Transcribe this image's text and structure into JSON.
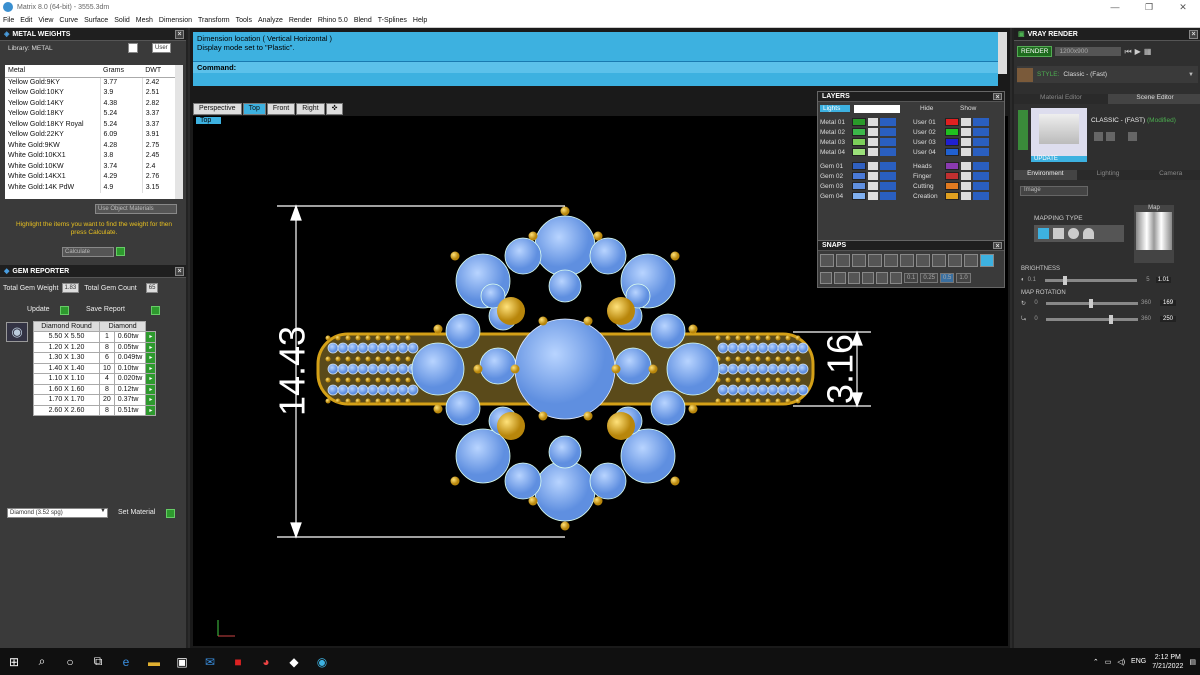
{
  "window": {
    "title": "Matrix 8.0 (64-bit) - 3555.3dm",
    "controls": [
      "—",
      "❐",
      "✕"
    ]
  },
  "menu": [
    "File",
    "Edit",
    "View",
    "Curve",
    "Surface",
    "Solid",
    "Mesh",
    "Dimension",
    "Transform",
    "Tools",
    "Analyze",
    "Render",
    "Rhino 5.0",
    "Blend",
    "T-Splines",
    "Help"
  ],
  "metal_weights": {
    "title": "METAL WEIGHTS",
    "library": "Library: METAL",
    "btn_user": "User",
    "col_metal": "Metal",
    "col_grams": "Grams",
    "col_dwt": "DWT",
    "rows": [
      [
        "Yellow Gold:9KY",
        "3.77",
        "2.42"
      ],
      [
        "Yellow Gold:10KY",
        "3.9",
        "2.51"
      ],
      [
        "Yellow Gold:14KY",
        "4.38",
        "2.82"
      ],
      [
        "Yellow Gold:18KY",
        "5.24",
        "3.37"
      ],
      [
        "Yellow Gold:18KY Royal",
        "5.24",
        "3.37"
      ],
      [
        "Yellow Gold:22KY",
        "6.09",
        "3.91"
      ],
      [
        "White Gold:9KW",
        "4.28",
        "2.75"
      ],
      [
        "White Gold:10KX1",
        "3.8",
        "2.45"
      ],
      [
        "White Gold:10KW",
        "3.74",
        "2.4"
      ],
      [
        "White Gold:14KX1",
        "4.29",
        "2.76"
      ],
      [
        "White Gold:14K PdW",
        "4.9",
        "3.15"
      ]
    ],
    "use_object": "Use Object Materials",
    "hint": "Highlight the items you want to find the weight for then press Calculate.",
    "calculate": "Calculate"
  },
  "gem_reporter": {
    "title": "GEM REPORTER",
    "total_weight_label": "Total Gem Weight",
    "total_weight": "1.83",
    "total_count_label": "Total Gem Count",
    "total_count": "65",
    "update": "Update",
    "save_report": "Save Report",
    "col_a": "Diamond Round",
    "col_b": "Diamond",
    "rows": [
      [
        "5.50 X 5.50",
        "1",
        "0.60tw"
      ],
      [
        "1.20 X 1.20",
        "8",
        "0.05tw"
      ],
      [
        "1.30 X 1.30",
        "6",
        "0.049tw"
      ],
      [
        "1.40 X 1.40",
        "10",
        "0.10tw"
      ],
      [
        "1.10 X 1.10",
        "4",
        "0.020tw"
      ],
      [
        "1.60 X 1.60",
        "8",
        "0.12tw"
      ],
      [
        "1.70 X 1.70",
        "20",
        "0.37tw"
      ],
      [
        "2.60 X 2.60",
        "8",
        "0.51tw"
      ]
    ],
    "material": "Diamond     (3.52 spg)",
    "set_material": "Set Material"
  },
  "command": {
    "line1": "Dimension location ( Vertical  Horizontal )",
    "line2": "Display mode set to \"Plastic\".",
    "prompt": "Command:"
  },
  "view_tabs": [
    "Perspective",
    "Top",
    "Front",
    "Right"
  ],
  "viewport": {
    "label": "Top",
    "dim_vertical": "14.43",
    "dim_horizontal": "3.16"
  },
  "layers": {
    "title": "LAYERS",
    "lights": "Lights",
    "hide": "Hide",
    "show": "Show",
    "left_group": [
      {
        "name": "Metal 01",
        "color": "#2a9a2a"
      },
      {
        "name": "Metal 02",
        "color": "#3cb84a"
      },
      {
        "name": "Metal 03",
        "color": "#7ccf5a"
      },
      {
        "name": "Metal 04",
        "color": "#9be07a"
      },
      {
        "name": "Gem 01",
        "color": "#3060c0"
      },
      {
        "name": "Gem 02",
        "color": "#4a7ad8"
      },
      {
        "name": "Gem 03",
        "color": "#6090e0"
      },
      {
        "name": "Gem 04",
        "color": "#80b0f0"
      }
    ],
    "right_group": [
      {
        "name": "User 01",
        "color": "#e02020"
      },
      {
        "name": "User 02",
        "color": "#20c020"
      },
      {
        "name": "User 03",
        "color": "#2020d0"
      },
      {
        "name": "User 04",
        "color": "#2060d0"
      },
      {
        "name": "Heads",
        "color": "#8a3ab0"
      },
      {
        "name": "Finger",
        "color": "#c03030"
      },
      {
        "name": "Cutting",
        "color": "#e07a20"
      },
      {
        "name": "Creation",
        "color": "#e0a020"
      }
    ]
  },
  "snaps": {
    "title": "SNAPS",
    "values": [
      "0.1",
      "0.25",
      "0.5",
      "1.0"
    ]
  },
  "vray": {
    "title": "VRAY RENDER",
    "render": "RENDER",
    "resolution": "1200x900",
    "style_label": "STYLE:",
    "style": "Classic - (Fast)",
    "tab_material": "Material Editor",
    "tab_scene": "Scene Editor",
    "preset": "CLASSIC - (FAST)",
    "modified": "(Modified)",
    "update": "UPDATE",
    "tabs": [
      "Environment",
      "Lighting",
      "Camera"
    ],
    "env_type": "Image",
    "mapping_type": "MAPPING TYPE",
    "map": "Map",
    "brightness_label": "BRIGHTNESS",
    "brightness_min": "0.1",
    "brightness_max": "5",
    "brightness_value": "1.01",
    "rotation_label": "MAP ROTATION",
    "rot1_min": "0",
    "rot1_max": "360",
    "rot1_value": "169",
    "rot2_min": "0",
    "rot2_max": "360",
    "rot2_value": "250"
  },
  "taskbar": {
    "lang": "ENG",
    "time": "2:12 PM",
    "date": "7/21/2022"
  }
}
